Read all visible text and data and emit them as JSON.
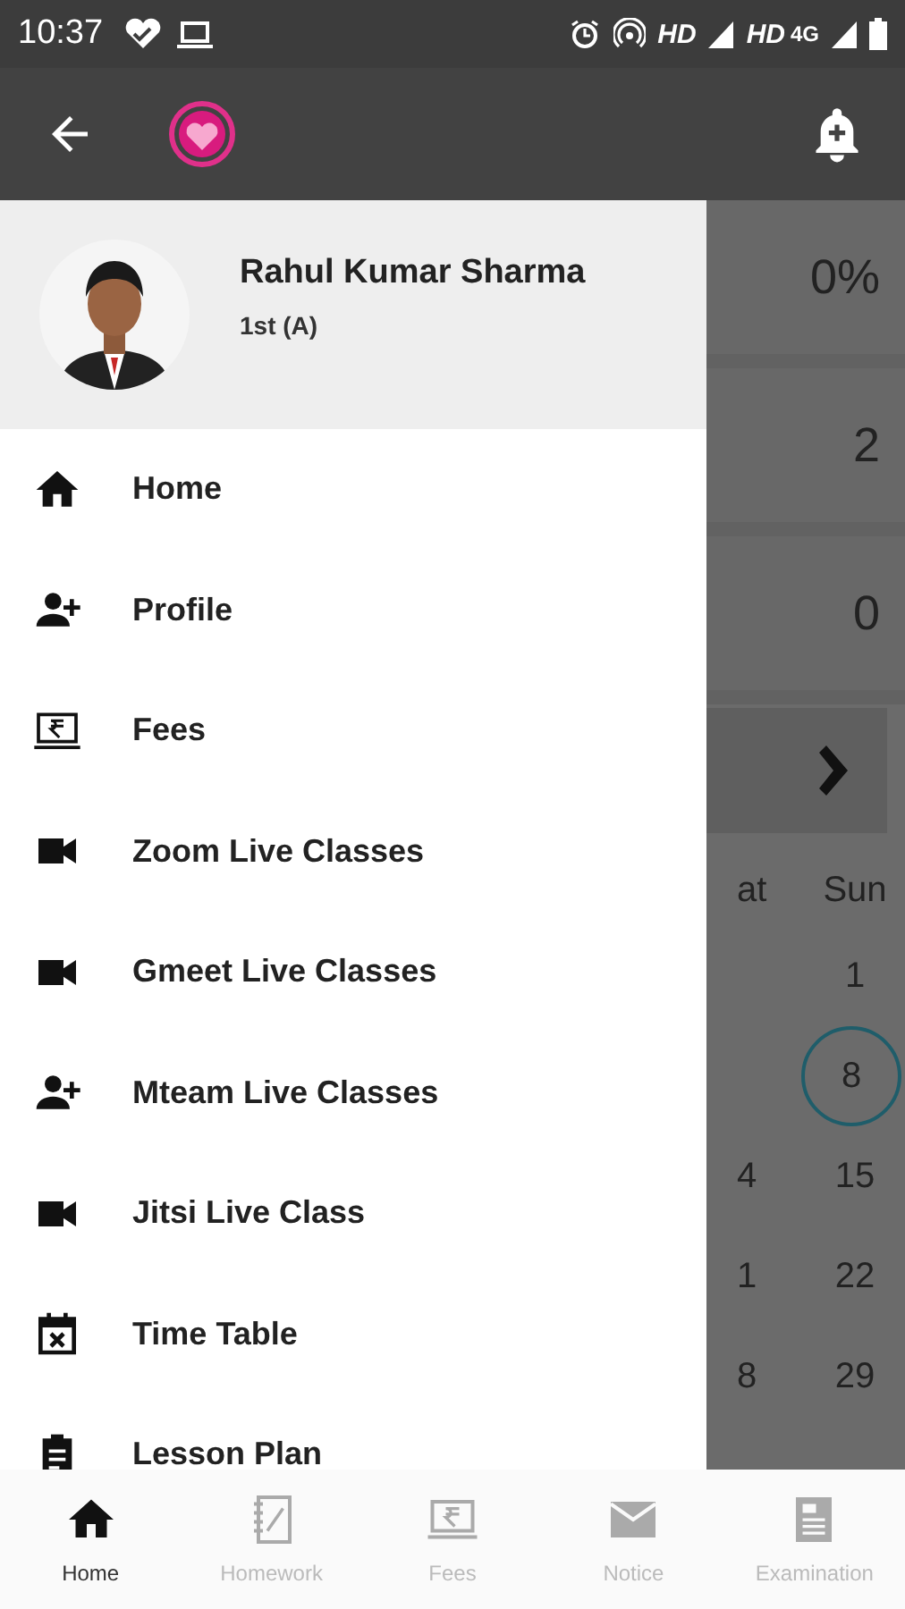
{
  "status_bar": {
    "time": "10:37",
    "network_1": "HD",
    "network_2": "HD",
    "network_3": "4G"
  },
  "drawer": {
    "name": "Rahul Kumar Sharma",
    "class": "1st (A)",
    "items": [
      {
        "label": "Home",
        "kind": "home"
      },
      {
        "label": "Profile",
        "kind": "person-add"
      },
      {
        "label": "Fees",
        "kind": "fees"
      },
      {
        "label": "Zoom Live Classes",
        "kind": "video"
      },
      {
        "label": "Gmeet Live Classes",
        "kind": "video"
      },
      {
        "label": "Mteam Live Classes",
        "kind": "person-add"
      },
      {
        "label": "Jitsi Live Class",
        "kind": "video"
      },
      {
        "label": "Time Table",
        "kind": "calendar"
      },
      {
        "label": "Lesson Plan",
        "kind": "clipboard"
      }
    ]
  },
  "main": {
    "cards": [
      "0%",
      "2",
      "0"
    ],
    "calendar": {
      "days": [
        "at",
        "Sun"
      ],
      "rows": [
        {
          "cells": [
            "1"
          ],
          "selected": false
        },
        {
          "cells": [
            "8"
          ],
          "selected": true
        },
        {
          "cells": [
            "4",
            "15"
          ],
          "selected": false
        },
        {
          "cells": [
            "1",
            "22"
          ],
          "selected": false
        },
        {
          "cells": [
            "8",
            "29"
          ],
          "selected": false
        }
      ]
    }
  },
  "bottom_nav": [
    {
      "label": "Home",
      "kind": "home",
      "selected": true
    },
    {
      "label": "Homework",
      "kind": "homework",
      "selected": false
    },
    {
      "label": "Fees",
      "kind": "fees",
      "selected": false
    },
    {
      "label": "Notice",
      "kind": "notice",
      "selected": false
    },
    {
      "label": "Examination",
      "kind": "exam",
      "selected": false
    }
  ]
}
